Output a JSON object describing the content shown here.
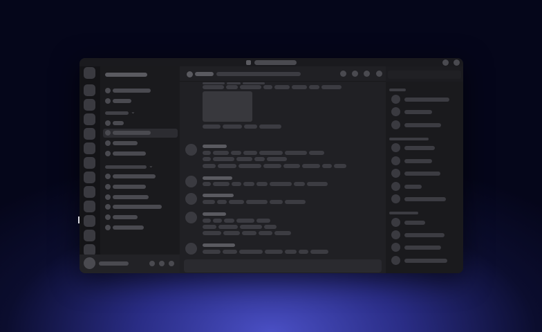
{
  "window": {
    "title_icon": "app-icon",
    "controls": [
      "minimize-icon",
      "close-icon"
    ]
  },
  "server_rail": {
    "servers": [
      "home-icon",
      "server-icon",
      "server-icon",
      "server-icon",
      "server-icon",
      "server-icon",
      "server-icon",
      "server-icon",
      "server-icon",
      "server-icon",
      "server-icon",
      "server-icon",
      "server-icon"
    ]
  },
  "sidebar": {
    "channels": [
      {
        "icon": "channel-icon"
      },
      {
        "icon": "channel-icon"
      },
      {
        "icon": "channel-icon"
      },
      {
        "icon": "channel-icon",
        "active": true
      },
      {
        "icon": "channel-icon"
      },
      {
        "icon": "channel-icon"
      },
      {
        "icon": "channel-icon"
      },
      {
        "icon": "channel-icon"
      },
      {
        "icon": "channel-icon"
      },
      {
        "icon": "channel-icon"
      },
      {
        "icon": "channel-icon"
      },
      {
        "icon": "channel-icon"
      },
      {
        "icon": "channel-icon"
      }
    ],
    "categories": [
      "chevron-down-icon",
      "chevron-down-icon"
    ]
  },
  "user_panel": {
    "controls": [
      "mic-icon",
      "headphones-icon",
      "settings-icon"
    ]
  },
  "chat_header": {
    "icon": "channel-icon",
    "buttons": [
      "threads-icon",
      "bell-icon",
      "pin-icon",
      "members-icon"
    ]
  },
  "colors": {
    "background_top": "#05061a",
    "background_glow": "#4a4fc4",
    "window": "#1c1c20",
    "rail": "#141417",
    "sidebar": "#1a1a1d",
    "chat": "#202024",
    "placeholder_bar": "#3c3c42",
    "caret": "#d8d8e0"
  }
}
